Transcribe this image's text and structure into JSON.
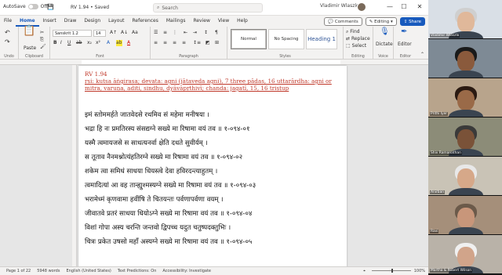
{
  "titlebar": {
    "autosave_label": "AutoSave",
    "autosave_state": "Off",
    "doc_title": "RV 1.94 • Saved",
    "search_placeholder": "Search",
    "user_name": "Vladimir Wlaszlo",
    "minimize": "—",
    "maximize": "☐",
    "close": "✕"
  },
  "menu": {
    "tabs": [
      "File",
      "Home",
      "Insert",
      "Draw",
      "Design",
      "Layout",
      "References",
      "Mailings",
      "Review",
      "View",
      "Help"
    ],
    "active": "Home",
    "comments": "Comments",
    "editing": "Editing",
    "share": "Share"
  },
  "ribbon": {
    "undo_label": "Undo",
    "paste_label": "Paste",
    "clipboard_label": "Clipboard",
    "font_name": "Sanskrit 1.2",
    "font_size": "14",
    "font_label": "Font",
    "paragraph_label": "Paragraph",
    "styles": [
      "Normal",
      "No Spacing",
      "Heading 1"
    ],
    "styles_label": "Styles",
    "find": "Find",
    "replace": "Replace",
    "select": "Select",
    "editing_label": "Editing",
    "dictate": "Dictate",
    "voice_label": "Voice",
    "editor": "Editor",
    "editor_label": "Editor"
  },
  "document": {
    "header_lines": [
      "RV 1.94",
      "ṛṣi: kutsa āṅgirasa; devata: agni (jātaveda agni), 7 three pādas, 16 uttarārdha: agni or",
      "mitra, varuṇa, aditi, sindhu, dyāvāpṛthivī; chanda: jagatī, 15, 16 triṣṭup"
    ],
    "verses": [
      "इमं स्तोममर्हते जातवेदसे रथमिव सं महेमा मनीषया ।",
      "भद्रा हि नः प्रमतिरस्य संसद्यग्ने सख्ये मा रिषामा वयं तव ॥ १-०९४-०१",
      "यस्मै त्वमायजसे स साधत्यनर्वा क्षेति दधते सुवीर्यम् ।",
      "स तूताव नैनमश्नोत्यंहतिरग्ने सख्ये मा रिषामा वयं तव ॥ १-०९४-०२",
      "शकेम त्वा समिधं साधया धियस्त्वे देवा हविरदन्त्याहुतम् ।",
      "त्वमादित्यां आ वह तान्ह्युश्मस्यग्ने सख्ये मा रिषामा वयं तव ॥ १-०९४-०३",
      "भरामेध्मं कृणवामा हवींषि ते चितयन्तः पर्वणापर्वणा वयम् ।",
      "जीवातवे प्रतरं साधया धियोऽग्ने सख्ये मा रिषामा वयं तव ॥ १-०९४-०४",
      "विशां गोपा अस्य चरन्ति जन्तवो द्विपच्च यदुत चतुष्पदक्तुभिः ।",
      "चित्रः प्रकेत उषसो महाँ अस्यग्ने सख्ये मा रिषामा वयं तव ॥ १-०९४-०५"
    ]
  },
  "statusbar": {
    "page": "Page 1 of 22",
    "words": "5948 words",
    "language": "English (United States)",
    "predictions": "Text Predictions: On",
    "accessibility": "Accessibility: Investigate",
    "zoom": "100%"
  },
  "video_tiles": [
    {
      "name": "Vladimir Wlaszlo"
    },
    {
      "name": ""
    },
    {
      "name": "Prithi Iyer"
    },
    {
      "name": "Shiv Ramanathan"
    },
    {
      "name": "Anirban"
    },
    {
      "name": "Ravi"
    },
    {
      "name": "Martha & Robert Wilson"
    }
  ],
  "colors": {
    "accent": "#185abd",
    "header_text": "#c0392b"
  }
}
